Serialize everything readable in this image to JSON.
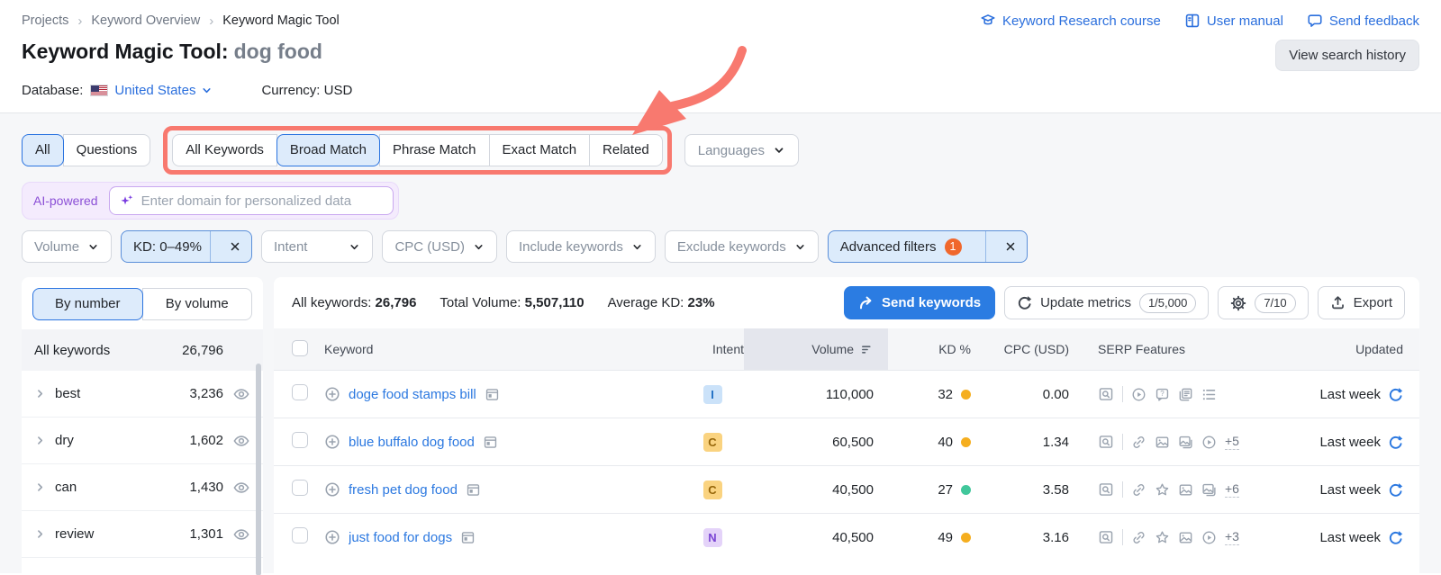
{
  "breadcrumb": {
    "items": [
      "Projects",
      "Keyword Overview",
      "Keyword Magic Tool"
    ]
  },
  "header_links": [
    {
      "label": "Keyword Research course",
      "icon": "course-icon"
    },
    {
      "label": "User manual",
      "icon": "manual-icon"
    },
    {
      "label": "Send feedback",
      "icon": "feedback-icon"
    }
  ],
  "title": {
    "main": "Keyword Magic Tool:",
    "query": "dog food"
  },
  "view_search_history": "View search history",
  "database_bar": {
    "database_label": "Database:",
    "database_value": "United States",
    "currency_label": "Currency:",
    "currency_value": "USD",
    "flag": "us-flag-icon"
  },
  "scope_tabs": {
    "items": [
      "All",
      "Questions"
    ],
    "selected": "All"
  },
  "match_tabs": {
    "items": [
      "All Keywords",
      "Broad Match",
      "Phrase Match",
      "Exact Match",
      "Related"
    ],
    "selected": "Broad Match"
  },
  "languages_dropdown": "Languages",
  "annotations": {
    "highlight_color": "#f8796f",
    "arrow": "red-arrow-pointing-at-match-tabs"
  },
  "ai_bar": {
    "badge": "AI-powered",
    "placeholder": "Enter domain for personalized data",
    "icon": "sparkles-icon"
  },
  "filters": {
    "volume": "Volume",
    "kd": "KD: 0–49%",
    "intent": "Intent",
    "cpc": "CPC (USD)",
    "include": "Include keywords",
    "exclude": "Exclude keywords",
    "advanced": "Advanced filters",
    "advanced_badge": "1"
  },
  "sidebar": {
    "tabs": [
      "By number",
      "By volume"
    ],
    "selected_tab": "By number",
    "all_row": {
      "label": "All keywords",
      "count": "26,796"
    },
    "groups": [
      {
        "label": "best",
        "count": "3,236"
      },
      {
        "label": "dry",
        "count": "1,602"
      },
      {
        "label": "can",
        "count": "1,430"
      },
      {
        "label": "review",
        "count": "1,301"
      }
    ]
  },
  "summary": {
    "all_keywords_label": "All keywords:",
    "all_keywords": "26,796",
    "total_volume_label": "Total Volume:",
    "total_volume": "5,507,110",
    "avg_kd_label": "Average KD:",
    "avg_kd": "23%"
  },
  "actions": {
    "send_keywords": "Send keywords",
    "update_metrics": "Update metrics",
    "update_quota": "1/5,000",
    "gear_quota": "7/10",
    "export": "Export"
  },
  "table": {
    "columns": [
      "Keyword",
      "Intent",
      "Volume",
      "KD %",
      "CPC (USD)",
      "SERP Features",
      "Updated"
    ],
    "sorted_column": "Volume",
    "rows": [
      {
        "keyword": "doge food stamps bill",
        "intent": "I",
        "intent_type": "informational",
        "volume": "110,000",
        "kd": "32",
        "kd_color": "#f5ae1f",
        "cpc": "0.00",
        "serp_icons": [
          "video-icon",
          "faq-icon",
          "sitelinks-icon",
          "list-icon"
        ],
        "serp_more": "",
        "updated": "Last week"
      },
      {
        "keyword": "blue buffalo dog food",
        "intent": "C",
        "intent_type": "commercial",
        "volume": "60,500",
        "kd": "40",
        "kd_color": "#f5ae1f",
        "cpc": "1.34",
        "serp_icons": [
          "link-icon",
          "image-icon",
          "image-pack-icon",
          "video-icon"
        ],
        "serp_more": "+5",
        "updated": "Last week"
      },
      {
        "keyword": "fresh pet dog food",
        "intent": "C",
        "intent_type": "commercial",
        "volume": "40,500",
        "kd": "27",
        "kd_color": "#41c79b",
        "cpc": "3.58",
        "serp_icons": [
          "link-icon",
          "star-icon",
          "image-icon",
          "image-pack-icon"
        ],
        "serp_more": "+6",
        "updated": "Last week"
      },
      {
        "keyword": "just food for dogs",
        "intent": "N",
        "intent_type": "navigational",
        "volume": "40,500",
        "kd": "49",
        "kd_color": "#f5ae1f",
        "cpc": "3.16",
        "serp_icons": [
          "link-icon",
          "star-icon",
          "image-icon",
          "video-icon"
        ],
        "serp_more": "+3",
        "updated": "Last week"
      }
    ]
  },
  "colors": {
    "accent_blue": "#2b74e0",
    "salmon_annotation": "#f8796f",
    "kd_orange": "#f5ae1f",
    "kd_green": "#41c79b"
  }
}
